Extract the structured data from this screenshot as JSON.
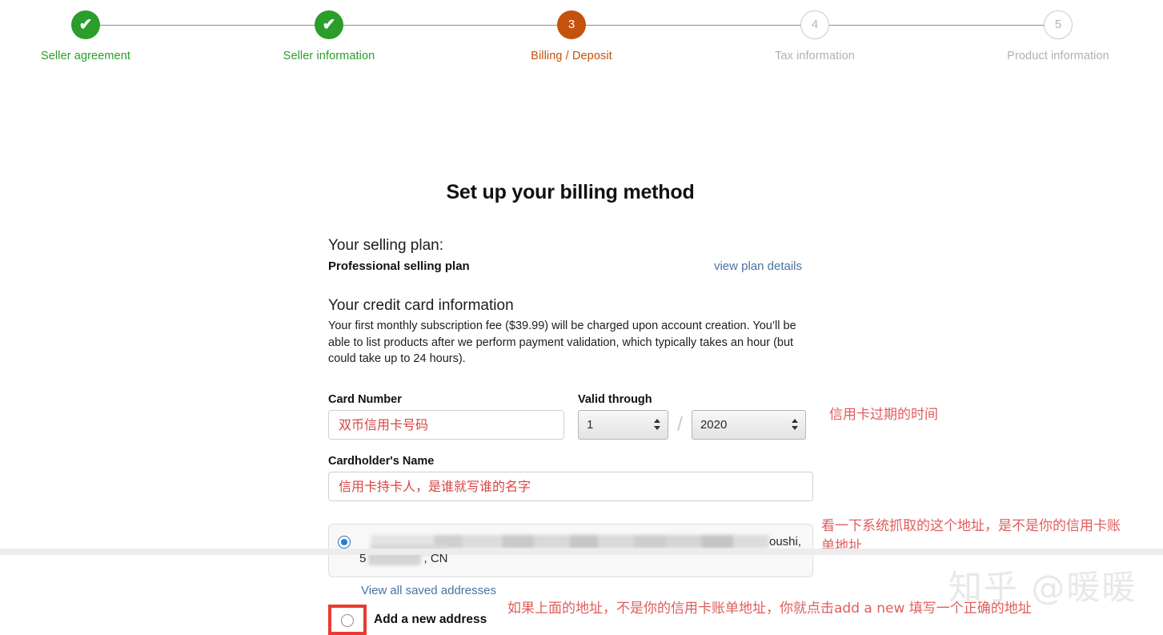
{
  "stepper": {
    "steps": [
      {
        "label": "Seller agreement",
        "marker": "✔",
        "state": "done"
      },
      {
        "label": "Seller information",
        "marker": "✔",
        "state": "done"
      },
      {
        "label": "Billing / Deposit",
        "marker": "3",
        "state": "current"
      },
      {
        "label": "Tax information",
        "marker": "4",
        "state": "todo"
      },
      {
        "label": "Product information",
        "marker": "5",
        "state": "todo"
      }
    ],
    "colors": {
      "done": "#2a9d2a",
      "current": "#c4520c",
      "todo": "#b0b0b0"
    }
  },
  "page": {
    "title": "Set up your billing method"
  },
  "plan": {
    "heading": "Your selling plan:",
    "name": "Professional selling plan",
    "details_link": "view plan details"
  },
  "credit_card": {
    "heading": "Your credit card information",
    "description": "Your first monthly subscription fee ($39.99) will be charged upon account creation. You’ll be able to list products after we perform payment validation, which typically takes an hour (but could take up to 24 hours).",
    "card_number_label": "Card Number",
    "card_number_value": "",
    "card_number_placeholder": "双币信用卡号码",
    "valid_through_label": "Valid through",
    "month_value": "1",
    "year_value": "2020",
    "separator": "/",
    "cardholder_label": "Cardholder's Name",
    "cardholder_value": "",
    "cardholder_placeholder": "信用卡持卡人，是谁就写谁的名字"
  },
  "address": {
    "saved": {
      "line1_tail": "oushi,",
      "line2_prefix": "5",
      "line2_tail": ", CN",
      "selected": true
    },
    "view_all_link": "View all saved addresses",
    "add_new_label": "Add a new address",
    "add_new_selected": false
  },
  "annotations": {
    "valid_through": "信用卡过期的时间",
    "saved_address": "看一下系统抓取的这个地址，是不是你的信用卡账\n单地址",
    "add_new": "如果上面的地址，不是你的信用卡账单地址，你就点击add a new 填写一个正确的地址",
    "color": "#e15c5c"
  },
  "watermark": {
    "text": "知乎 @暖暖"
  }
}
